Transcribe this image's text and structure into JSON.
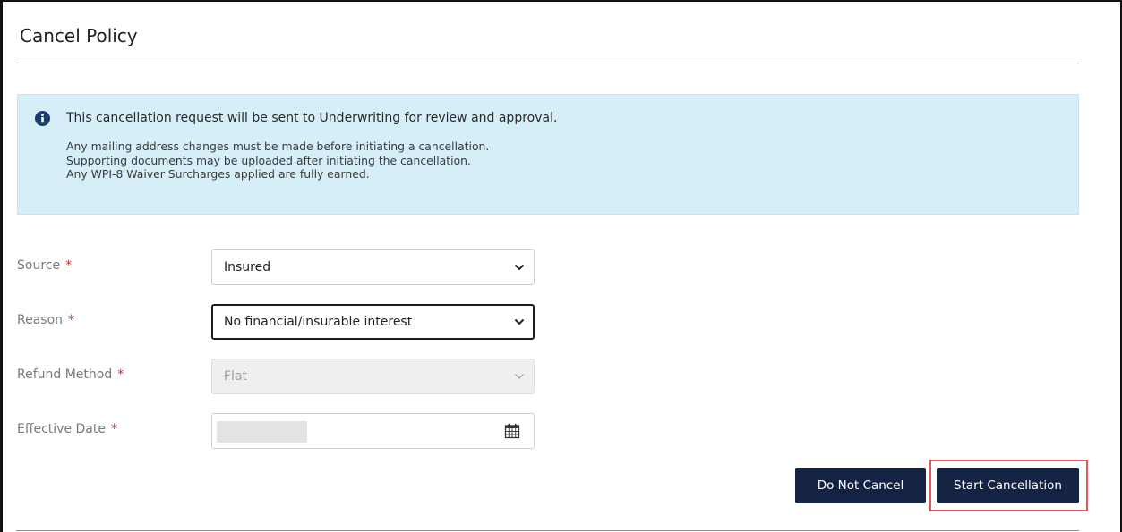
{
  "page": {
    "title": "Cancel Policy"
  },
  "alert": {
    "icon": "info-circle-icon",
    "message": "This cancellation request will be sent to Underwriting for review and approval.",
    "lines": [
      "Any mailing address changes must be made before initiating a cancellation.",
      "Supporting documents may be uploaded after initiating the cancellation.",
      "Any WPI-8 Waiver Surcharges applied are fully earned."
    ],
    "background_color": "#d5eef8",
    "icon_color": "#1a3c6e"
  },
  "form": {
    "required_marker": "*",
    "source": {
      "label": "Source",
      "value": "Insured"
    },
    "reason": {
      "label": "Reason",
      "value": "No financial/insurable interest"
    },
    "refund_method": {
      "label": "Refund Method",
      "value": "Flat"
    },
    "effective_date": {
      "label": "Effective Date",
      "icon": "calendar-icon"
    }
  },
  "actions": {
    "do_not_cancel_label": "Do Not Cancel",
    "start_cancellation_label": "Start Cancellation",
    "button_color": "#142343",
    "highlight_color": "#e0565a"
  }
}
